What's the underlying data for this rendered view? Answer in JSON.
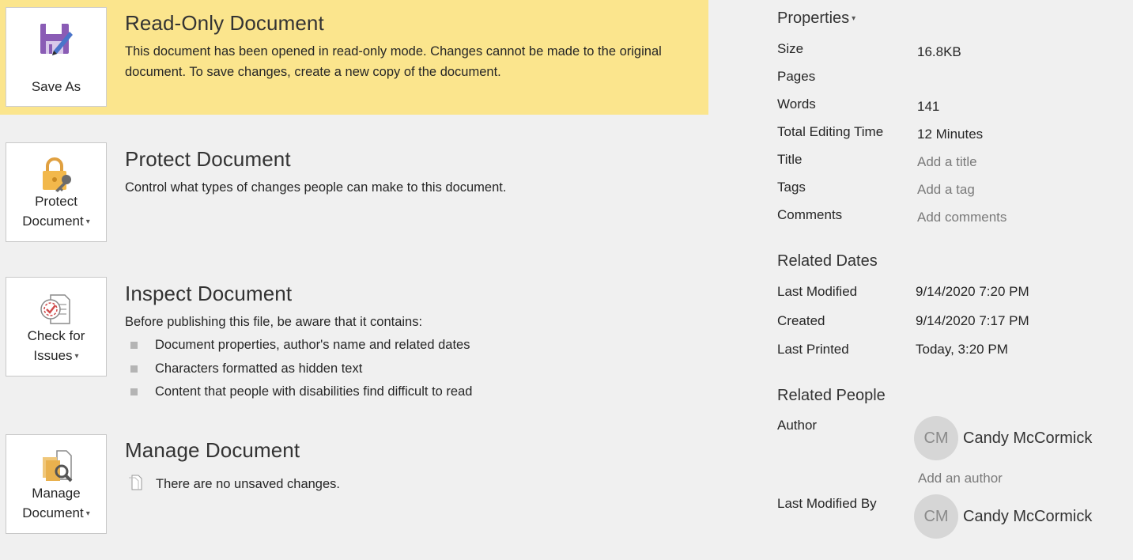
{
  "read_only": {
    "button_label": "Save As",
    "title": "Read-Only Document",
    "description": "This document has been opened in read-only mode. Changes cannot be made to the original document. To save changes, create a new copy of the document.",
    "background": "#fbe58d"
  },
  "protect": {
    "button_line1": "Protect",
    "button_line2": "Document",
    "title": "Protect Document",
    "description": "Control what types of changes people can make to this document."
  },
  "inspect": {
    "button_line1": "Check for",
    "button_line2": "Issues",
    "title": "Inspect Document",
    "description": "Before publishing this file, be aware that it contains:",
    "items": [
      "Document properties, author's name and related dates",
      "Characters formatted as hidden text",
      "Content that people with disabilities find difficult to read"
    ]
  },
  "manage": {
    "button_line1": "Manage",
    "button_line2": "Document",
    "title": "Manage Document",
    "status": "There are no unsaved changes."
  },
  "properties": {
    "heading": "Properties",
    "rows": [
      {
        "key": "Size",
        "value": "16.8KB"
      },
      {
        "key": "Pages",
        "value": ""
      },
      {
        "key": "Words",
        "value": "141"
      },
      {
        "key": "Total Editing Time",
        "value": "12 Minutes"
      },
      {
        "key": "Title",
        "value": "Add a title"
      },
      {
        "key": "Tags",
        "value": "Add a tag"
      },
      {
        "key": "Comments",
        "value": "Add comments"
      }
    ]
  },
  "related_dates": {
    "heading": "Related Dates",
    "rows": [
      {
        "key": "Last Modified",
        "value": "9/14/2020 7:20 PM"
      },
      {
        "key": "Created",
        "value": "9/14/2020 7:17 PM"
      },
      {
        "key": "Last Printed",
        "value": "Today, 3:20 PM"
      }
    ]
  },
  "related_people": {
    "heading": "Related People",
    "author_label": "Author",
    "author_initials": "CM",
    "author_name": "Candy McCormick",
    "add_author": "Add an author",
    "last_modified_by_label": "Last Modified By",
    "last_modified_initials": "CM",
    "last_modified_name": "Candy McCormick"
  }
}
